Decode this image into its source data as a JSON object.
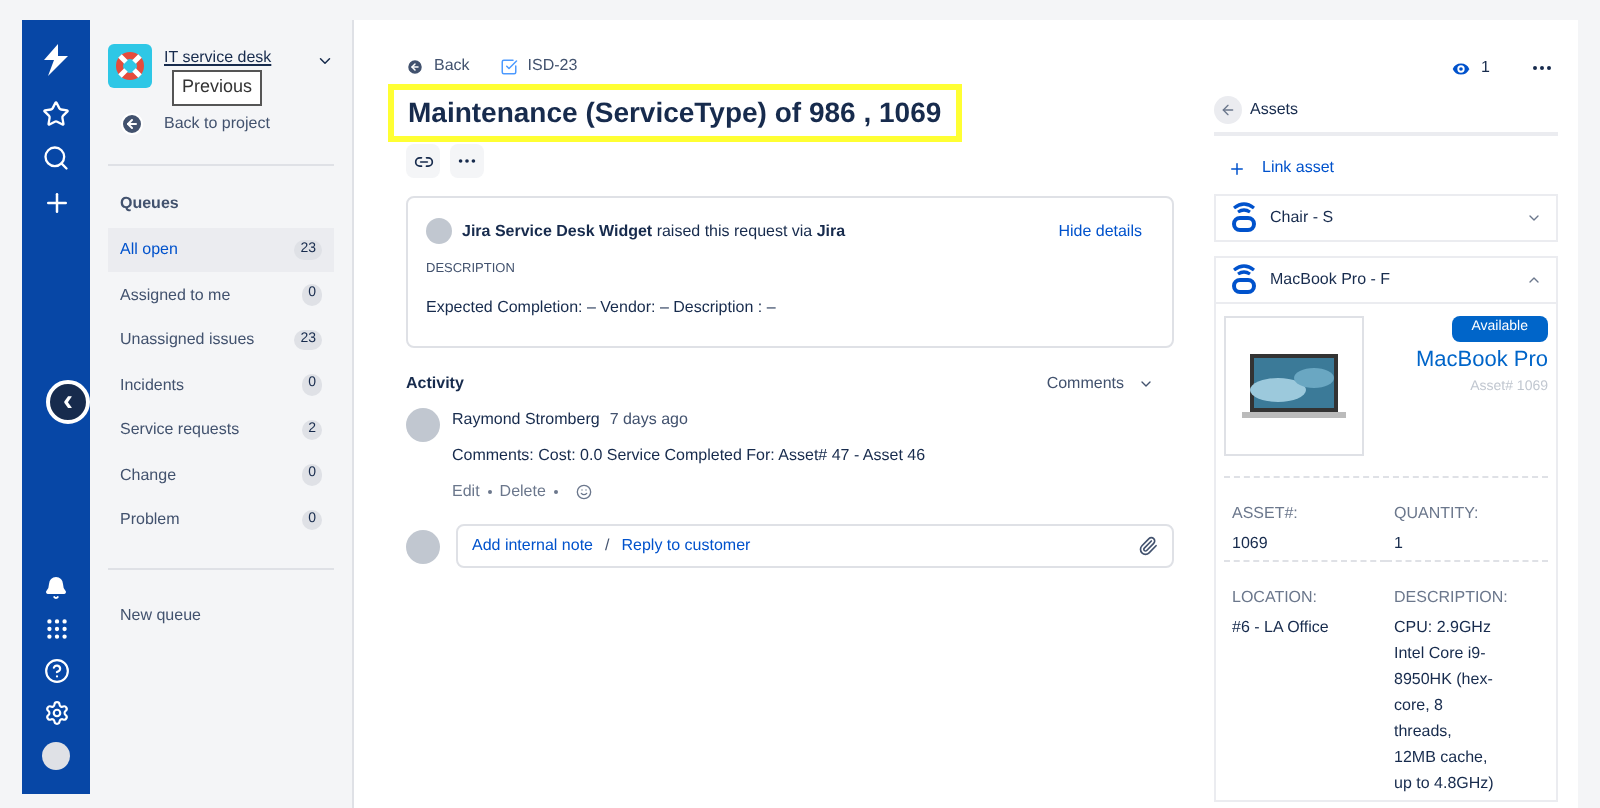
{
  "nav": {
    "collapse_label": "‹"
  },
  "project": {
    "name": "IT service desk",
    "tooltip": "Previous",
    "back": "Back to project"
  },
  "queues": {
    "title": "Queues",
    "items": [
      {
        "label": "All open",
        "count": "23",
        "selected": true
      },
      {
        "label": "Assigned to me",
        "count": "0",
        "selected": false
      },
      {
        "label": "Unassigned issues",
        "count": "23",
        "selected": false
      },
      {
        "label": "Incidents",
        "count": "0",
        "selected": false
      },
      {
        "label": "Service requests",
        "count": "2",
        "selected": false
      },
      {
        "label": "Change",
        "count": "0",
        "selected": false
      },
      {
        "label": "Problem",
        "count": "0",
        "selected": false
      }
    ],
    "new_queue": "New queue"
  },
  "issue": {
    "back": "Back",
    "key": "ISD-23",
    "title": "Maintenance (ServiceType) of 986 , 1069",
    "watchers": "1",
    "request": {
      "text": "**Jira Service Desk Widget** raised this request via **Jira**",
      "hide": "Hide details",
      "desc_label": "DESCRIPTION",
      "desc": "Expected Completion: – Vendor: – Description : –"
    },
    "activity": {
      "title": "Activity",
      "filter": "Comments",
      "comments": [
        {
          "author": "Raymond Stromberg",
          "time": "7 days ago",
          "body": "Comments: Cost: 0.0 Service Completed For: Asset# 47 - Asset 46",
          "actions": [
            "Edit",
            "Delete"
          ]
        }
      ],
      "add_note": "Add internal note",
      "separator": "/",
      "reply": "Reply to customer"
    }
  },
  "assets": {
    "title": "Assets",
    "link": "Link asset",
    "items": [
      {
        "name": "Chair - S",
        "expanded": false
      },
      {
        "name": "MacBook Pro - F",
        "expanded": true,
        "status": "Available",
        "title": "MacBook Pro",
        "asset_no": "Asset# 1069",
        "fields": [
          {
            "label": "ASSET#:",
            "lines": [
              "1069"
            ]
          },
          {
            "label": "QUANTITY:",
            "lines": [
              "1"
            ]
          },
          {
            "label": "LOCATION:",
            "lines": [
              "#6 - LA Office"
            ]
          },
          {
            "label": "DESCRIPTION:",
            "lines": [
              "CPU: 2.9GHz",
              "Intel Core i9-",
              "8950HK (hex-",
              "core, 8",
              "threads,",
              "12MB cache,",
              "up to 4.8GHz)"
            ]
          }
        ]
      }
    ]
  }
}
